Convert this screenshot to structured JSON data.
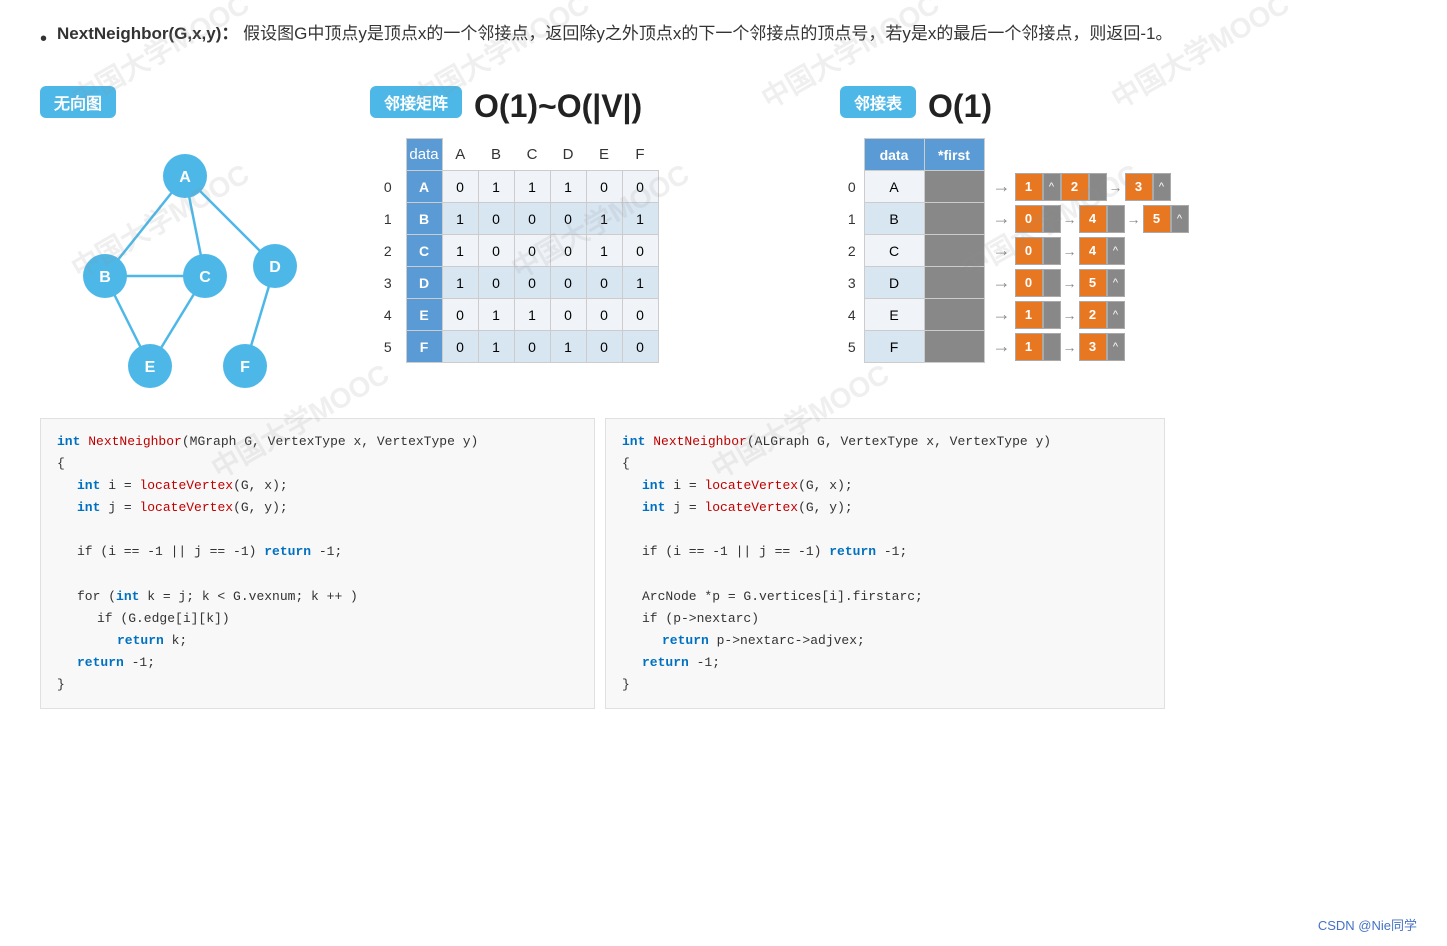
{
  "watermarks": [
    "中国大学MOOC",
    "中国大学MOOC",
    "中国大学MOOC",
    "中国大学MOOC"
  ],
  "top_bullet": {
    "func": "NextNeighbor(G,x,y)：",
    "text": "假设图G中顶点y是顶点x的一个邻接点，返回除y之外顶点x的下一个邻接点的顶点号，若y是x的最后一个邻接点，则返回-1。"
  },
  "graph_label": "无向图",
  "matrix_label": "邻接矩阵",
  "matrix_complexity": "O(1)~O(|V|)",
  "adjlist_label": "邻接表",
  "adjlist_complexity": "O(1)",
  "graph_nodes": [
    "A",
    "B",
    "C",
    "D",
    "E",
    "F"
  ],
  "matrix_headers": [
    "data",
    "A",
    "B",
    "C",
    "D",
    "E",
    "F"
  ],
  "matrix_rows": [
    {
      "idx": "0",
      "data": "A",
      "vals": [
        0,
        1,
        1,
        1,
        0,
        0
      ]
    },
    {
      "idx": "1",
      "data": "B",
      "vals": [
        1,
        0,
        0,
        0,
        1,
        1
      ]
    },
    {
      "idx": "2",
      "data": "C",
      "vals": [
        1,
        0,
        0,
        0,
        1,
        0
      ]
    },
    {
      "idx": "3",
      "data": "D",
      "vals": [
        1,
        0,
        0,
        0,
        0,
        1
      ]
    },
    {
      "idx": "4",
      "data": "E",
      "vals": [
        0,
        1,
        1,
        0,
        0,
        0
      ]
    },
    {
      "idx": "5",
      "data": "F",
      "vals": [
        0,
        1,
        0,
        1,
        0,
        0
      ]
    }
  ],
  "adjlist_rows": [
    {
      "idx": "0",
      "data": "A",
      "links": [
        {
          "val": "1",
          "ptr": "^"
        },
        {
          "val": "2",
          "ptr": ""
        },
        {
          "val": "3",
          "ptr": "^"
        }
      ]
    },
    {
      "idx": "1",
      "data": "B",
      "links": [
        {
          "val": "0",
          "ptr": ""
        },
        {
          "val": "4",
          "ptr": ""
        },
        {
          "val": "5",
          "ptr": "^"
        }
      ]
    },
    {
      "idx": "2",
      "data": "C",
      "links": [
        {
          "val": "0",
          "ptr": ""
        },
        {
          "val": "4",
          "ptr": "^"
        }
      ]
    },
    {
      "idx": "3",
      "data": "D",
      "links": [
        {
          "val": "0",
          "ptr": ""
        },
        {
          "val": "5",
          "ptr": "^"
        }
      ]
    },
    {
      "idx": "4",
      "data": "E",
      "links": [
        {
          "val": "1",
          "ptr": ""
        },
        {
          "val": "2",
          "ptr": "^"
        }
      ]
    },
    {
      "idx": "5",
      "data": "F",
      "links": [
        {
          "val": "1",
          "ptr": ""
        },
        {
          "val": "3",
          "ptr": "^"
        }
      ]
    }
  ],
  "code_mgraph": {
    "line1": "int NextNeighbor(MGraph G, VertexType x, VertexType y)",
    "line2": "{",
    "line3": "    int i = locateVertex(G, x);",
    "line4": "    int j = locateVertex(G, y);",
    "line5": "",
    "line6": "    if (i == -1 || j == -1) return -1;",
    "line7": "",
    "line8": "    for (int k = j; k < G.vexnum; k ++ )",
    "line9": "        if (G.edge[i][k])",
    "line10": "            return k;",
    "line11": "    return -1;",
    "line12": "}"
  },
  "code_algraph": {
    "line1": "int NextNeighbor(ALGraph G, VertexType x, VertexType y)",
    "line2": "{",
    "line3": "    int i = locateVertex(G, x);",
    "line4": "    int j = locateVertex(G, y);",
    "line5": "",
    "line6": "    if (i == -1 || j == -1) return -1;",
    "line7": "",
    "line8": "    ArcNode *p = G.vertices[i].firstarc;",
    "line9": "    if (p->nextarc)",
    "line10": "        return p->nextarc->adjvex;",
    "line11": "    return -1;",
    "line12": "}"
  },
  "credit": "CSDN @Nie同学"
}
